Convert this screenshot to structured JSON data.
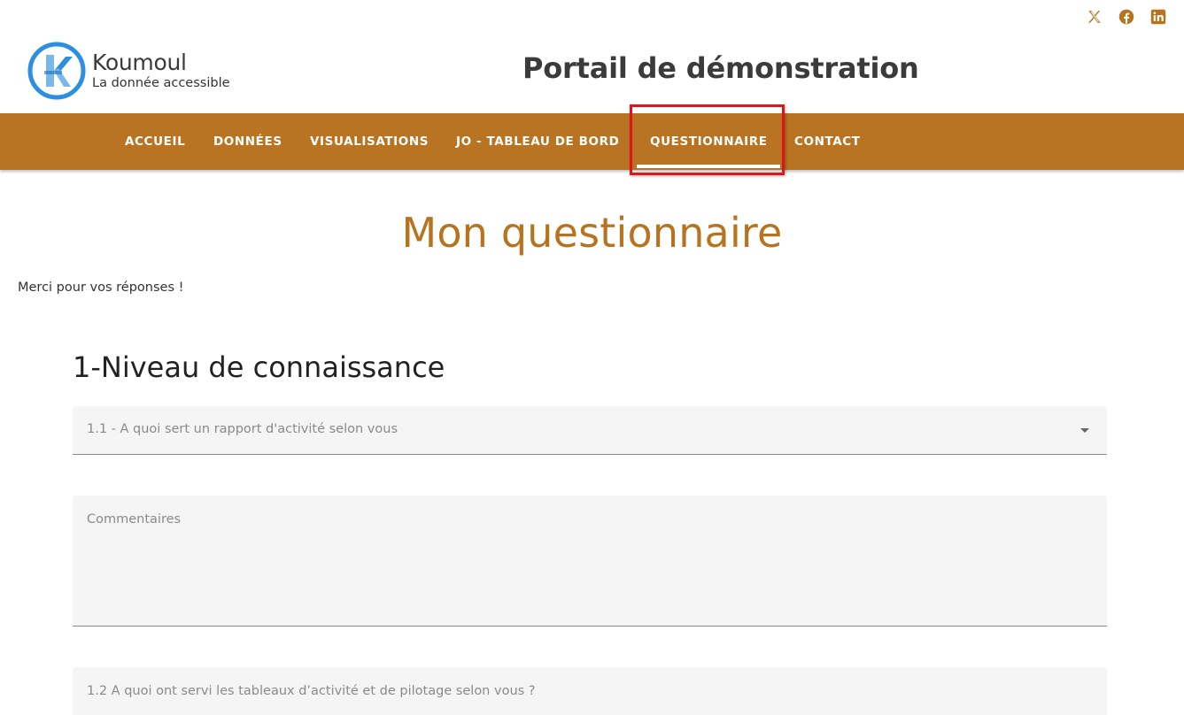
{
  "social": {
    "icons": [
      "x-twitter-icon",
      "facebook-icon",
      "linkedin-icon"
    ],
    "color": "#b8731f"
  },
  "header": {
    "logo_name": "Koumoul",
    "logo_tagline": "La donnée accessible",
    "portal_title": "Portail de démonstration"
  },
  "nav": {
    "background": "#b87422",
    "items": [
      {
        "label": "ACCUEIL"
      },
      {
        "label": "DONNÉES"
      },
      {
        "label": "VISUALISATIONS"
      },
      {
        "label": "JO - TABLEAU DE BORD"
      },
      {
        "label": "QUESTIONNAIRE",
        "active": true
      },
      {
        "label": "CONTACT"
      }
    ],
    "highlight_color": "#e0141b"
  },
  "main": {
    "title": "Mon questionnaire",
    "title_color": "#b8731f",
    "thanks": "Merci pour vos réponses !",
    "section_title": "1-Niveau de connaissance",
    "fields": {
      "q1_label": "1.1 - A quoi sert un rapport d'activité selon vous",
      "comments_label": "Commentaires",
      "q2_label": "1.2 A quoi ont servi les tableaux d’activité et de pilotage selon vous ?"
    }
  }
}
